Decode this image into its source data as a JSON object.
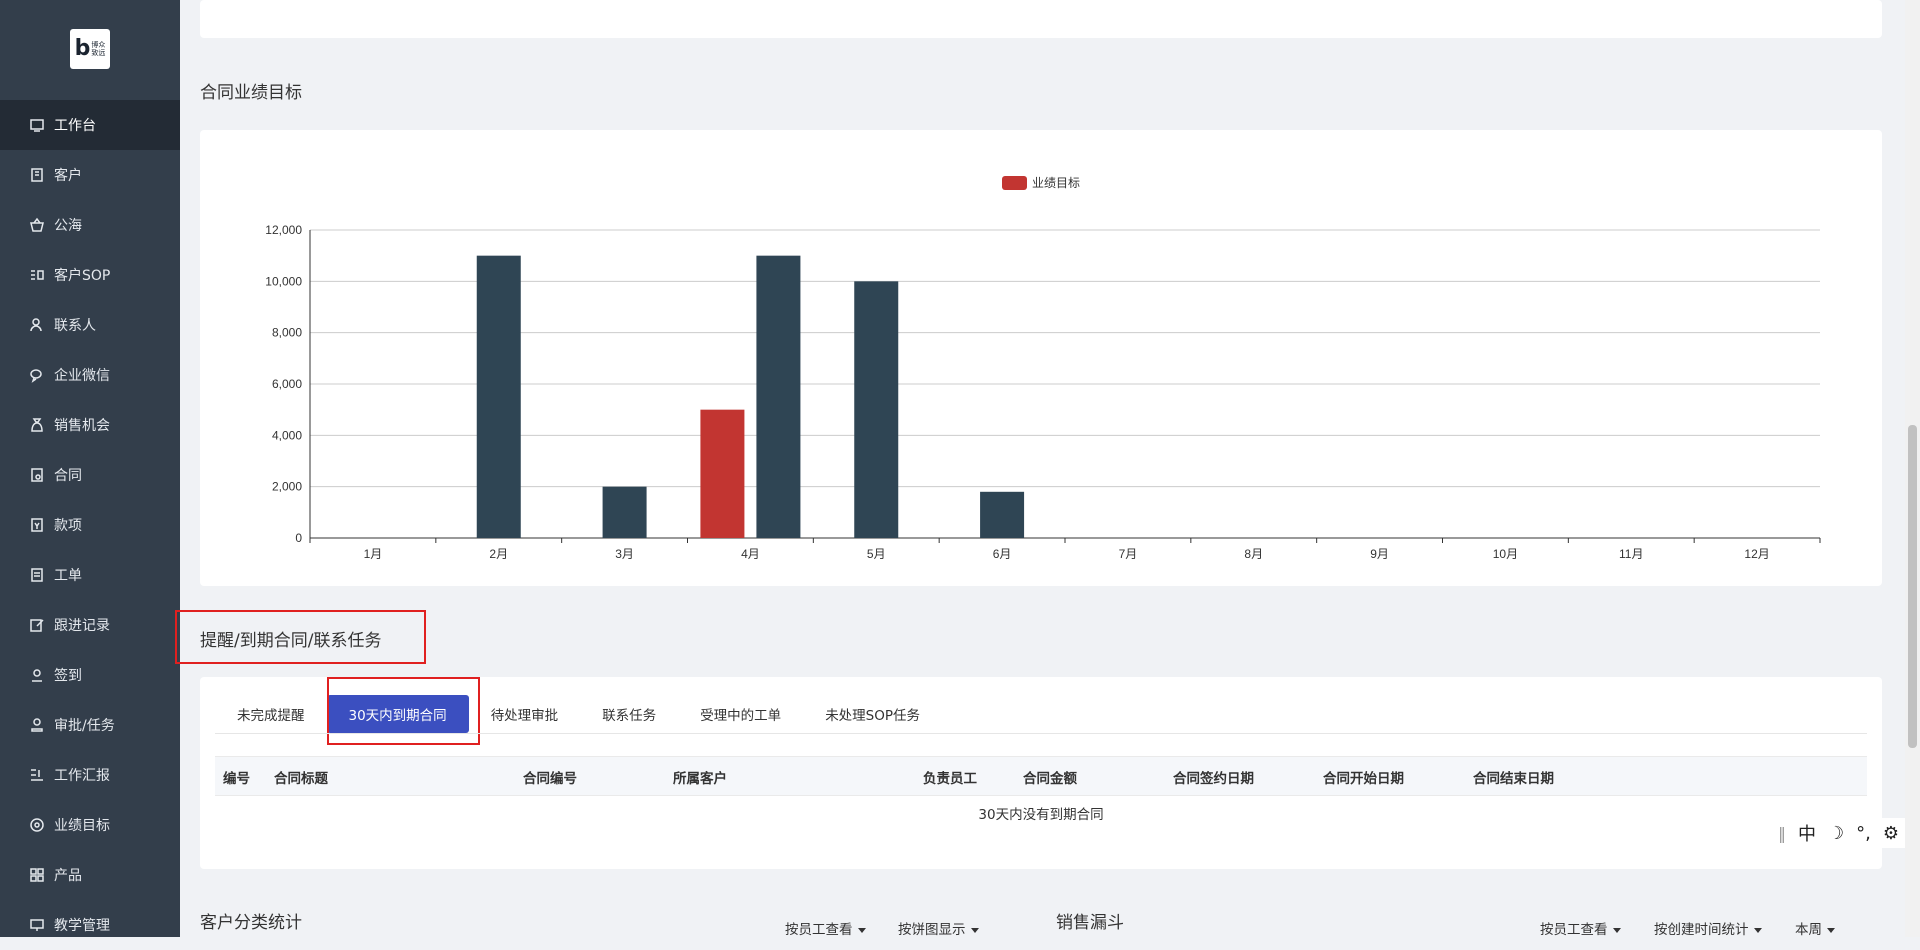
{
  "logo": {
    "letter": "b",
    "line1": "博众",
    "line2": "致远"
  },
  "sidebar": {
    "items": [
      {
        "label": "工作台",
        "icon": "monitor-icon",
        "active": true
      },
      {
        "label": "客户",
        "icon": "building-icon"
      },
      {
        "label": "公海",
        "icon": "basket-icon"
      },
      {
        "label": "客户SOP",
        "icon": "sop-icon"
      },
      {
        "label": "联系人",
        "icon": "contact-icon"
      },
      {
        "label": "企业微信",
        "icon": "wechat-icon"
      },
      {
        "label": "销售机会",
        "icon": "money-bag-icon"
      },
      {
        "label": "合同",
        "icon": "contract-icon"
      },
      {
        "label": "款项",
        "icon": "payment-icon"
      },
      {
        "label": "工单",
        "icon": "ticket-icon"
      },
      {
        "label": "跟进记录",
        "icon": "edit-icon"
      },
      {
        "label": "签到",
        "icon": "location-icon"
      },
      {
        "label": "审批/任务",
        "icon": "stamp-icon"
      },
      {
        "label": "工作汇报",
        "icon": "report-icon"
      },
      {
        "label": "业绩目标",
        "icon": "target-icon"
      },
      {
        "label": "产品",
        "icon": "grid-icon"
      },
      {
        "label": "教学管理",
        "icon": "teach-icon"
      }
    ]
  },
  "sections": {
    "performance_title": "合同业绩目标",
    "reminder_title": "提醒/到期合同/联系任务",
    "customer_stats_title": "客户分类统计",
    "funnel_title": "销售漏斗"
  },
  "chart_data": {
    "type": "bar",
    "legend": [
      "业绩目标"
    ],
    "legend_position": "top-center",
    "categories": [
      "1月",
      "2月",
      "3月",
      "4月",
      "5月",
      "6月",
      "7月",
      "8月",
      "9月",
      "10月",
      "11月",
      "12月"
    ],
    "series": [
      {
        "name": "业绩目标",
        "color": "#c23531",
        "values": [
          0,
          0,
          0,
          5000,
          0,
          0,
          0,
          0,
          0,
          0,
          0,
          0
        ]
      },
      {
        "name": "",
        "color": "#2f4554",
        "values": [
          0,
          11000,
          2000,
          11000,
          10000,
          1800,
          0,
          0,
          0,
          0,
          0,
          0
        ]
      }
    ],
    "ylim": [
      0,
      12000
    ],
    "yticks": [
      "0",
      "2,000",
      "4,000",
      "6,000",
      "8,000",
      "10,000",
      "12,000"
    ],
    "grid": true
  },
  "tabs": [
    {
      "label": "未完成提醒"
    },
    {
      "label": "30天内到期合同",
      "active": true
    },
    {
      "label": "待处理审批"
    },
    {
      "label": "联系任务"
    },
    {
      "label": "受理中的工单"
    },
    {
      "label": "未处理SOP任务"
    }
  ],
  "table": {
    "headers": [
      "编号",
      "合同标题",
      "合同编号",
      "所属客户",
      "负责员工",
      "合同金额",
      "合同签约日期",
      "合同开始日期",
      "合同结束日期"
    ],
    "empty_text": "30天内没有到期合同"
  },
  "customer_stats_dropdowns": [
    "按员工查看",
    "按饼图显示"
  ],
  "funnel_dropdowns": [
    "按员工查看",
    "按创建时间统计",
    "本周"
  ],
  "ime_bar": {
    "lang": "中",
    "moon": "☽",
    "punct": "°,",
    "gear": "⚙"
  },
  "colors": {
    "sidebar_bg": "#333e4b",
    "sidebar_active": "#232b35",
    "tab_active": "#3b4fc0",
    "highlight": "#e02020"
  }
}
